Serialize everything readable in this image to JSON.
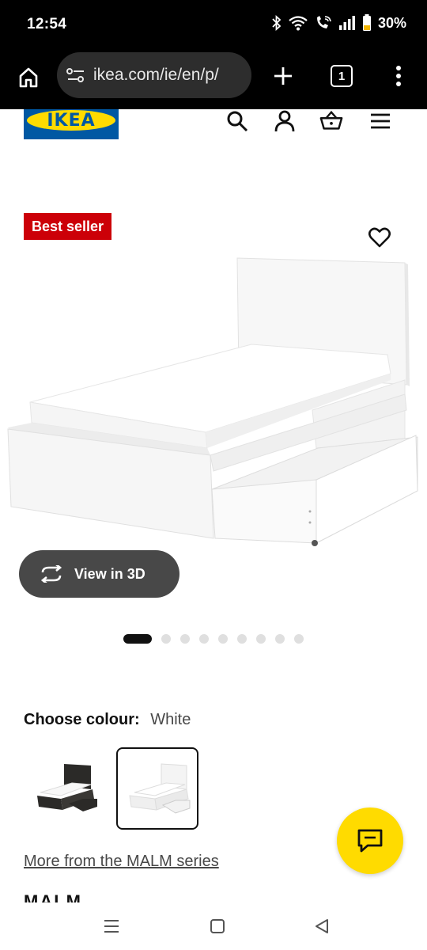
{
  "status_bar": {
    "time": "12:54",
    "battery": "30%",
    "icons": [
      "bluetooth-icon",
      "wifi-icon",
      "wifi-call-icon",
      "signal-icon",
      "battery-icon"
    ]
  },
  "browser": {
    "url": "ikea.com/ie/en/p/",
    "tab_count": "1"
  },
  "header": {
    "logo_text": "IKEA",
    "icons": [
      "search-icon",
      "account-icon",
      "basket-icon",
      "hamburger-menu-icon"
    ]
  },
  "product": {
    "badge": "Best seller",
    "view_3d_label": "View in 3D",
    "image_count": 10,
    "active_image": 1
  },
  "colour": {
    "label": "Choose colour:",
    "value": "White",
    "options": [
      "Black-brown",
      "White"
    ],
    "selected_index": 1
  },
  "series_link": "More from the MALM series",
  "cut_heading": "MALM",
  "colors": {
    "ikea_blue": "#0058a3",
    "ikea_yellow": "#ffdb00",
    "badge_red": "#cc0008",
    "button_grey": "#484848"
  }
}
